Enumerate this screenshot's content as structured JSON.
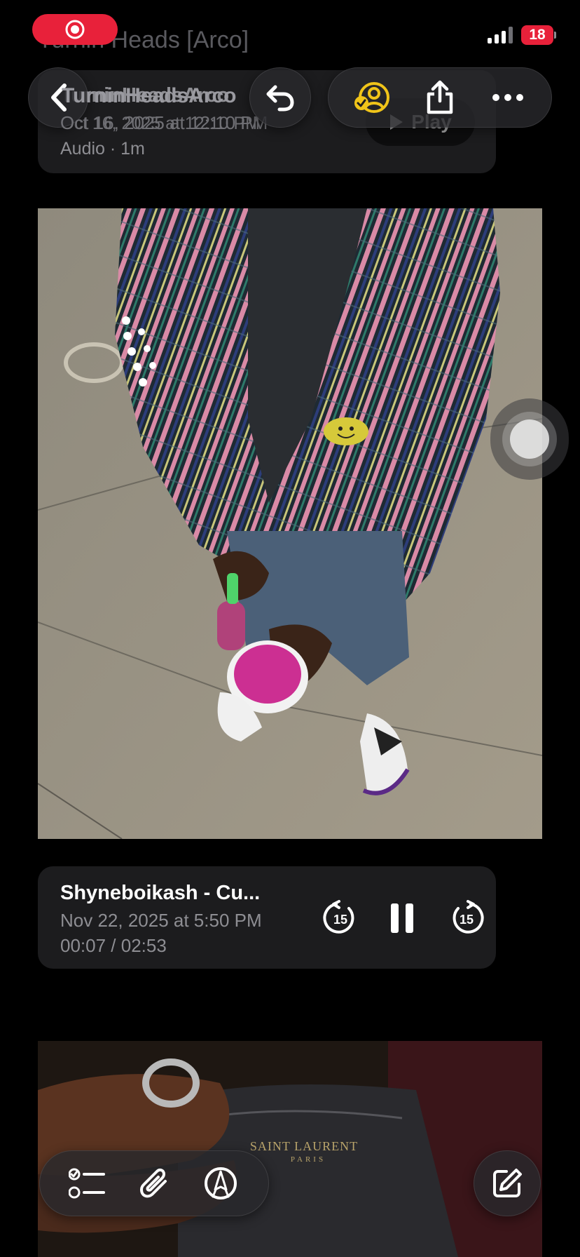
{
  "status_bar": {
    "battery_level": "18",
    "recording_indicator": "screen-recording"
  },
  "note": {
    "title": "Turnin Heads [Arco]"
  },
  "toolbar": {
    "back_icon": "chevron-left-icon",
    "undo_icon": "undo-icon",
    "collaborate_icon": "person-check-icon",
    "share_icon": "share-icon",
    "more_icon": "ellipsis-icon",
    "overlay_title": "TurninHeadsArco",
    "overlay_date": "Oct 16, 2025 at 12:10 PM"
  },
  "top_audio_card": {
    "title": "TurninHeadsArco",
    "date": "Oct 16, 2025 at 12:10 PM",
    "meta": "Audio · 1m",
    "play_label": "Play"
  },
  "audio_player": {
    "title": "Shyneboikash - Cu...",
    "date": "Nov 22, 2025 at 5:50 PM",
    "progress": "00:07 / 02:53",
    "skip_back_seconds": "15",
    "skip_forward_seconds": "15"
  },
  "photo_2_text": {
    "brand": "SAINT LAURENT",
    "city": "PARIS"
  },
  "bottom_toolbar": {
    "checklist_icon": "checklist-icon",
    "attachment_icon": "paperclip-icon",
    "markup_icon": "pen-circle-icon",
    "compose_icon": "compose-icon"
  },
  "colors": {
    "accent_red": "#e8213a",
    "card_bg": "#1c1c1e",
    "secondary_text": "#8e8e93",
    "collab_yellow": "#f0c419"
  }
}
